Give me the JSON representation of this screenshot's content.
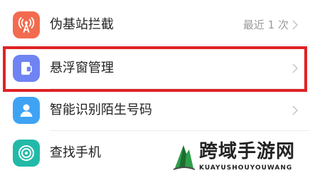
{
  "settings_list": {
    "items": [
      {
        "label": "伪基站拦截",
        "value": "最近 1 次",
        "icon": "antenna-tower-icon",
        "icon_color": "#f26b4f"
      },
      {
        "label": "悬浮窗管理",
        "icon": "floating-window-icon",
        "icon_color": "#6f83f2"
      },
      {
        "label": "智能识别陌生号码",
        "icon": "person-icon",
        "icon_color": "#3fa3f4"
      },
      {
        "label": "查找手机",
        "icon": "radar-find-icon",
        "icon_color": "#23b9a8"
      }
    ]
  },
  "watermark": {
    "title": "跨域手游网",
    "subtitle": "KUAYUSHOUYOUWANG"
  },
  "colors": {
    "highlight_border": "#e02224",
    "chevron": "#c4c4c4",
    "label_text": "#222222",
    "value_text": "#9a9a9a"
  }
}
